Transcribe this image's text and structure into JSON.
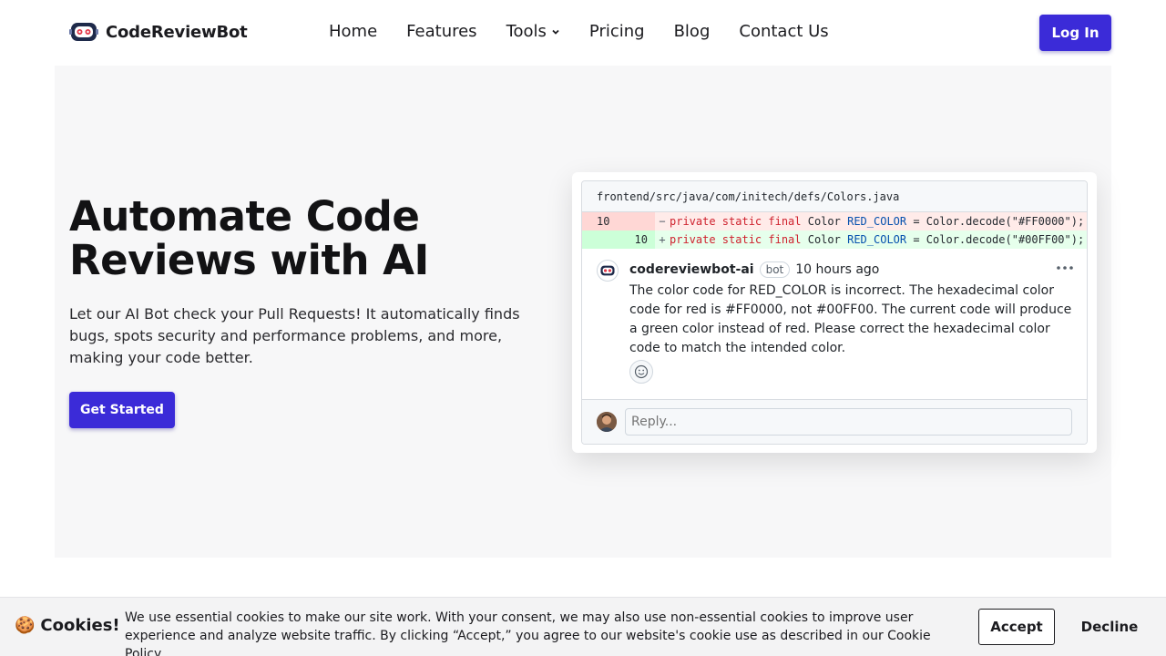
{
  "brand": {
    "name": "CodeReviewBot",
    "accent": "#3b2bd8",
    "logo_icon": "robot-icon"
  },
  "nav": {
    "items": [
      {
        "label": "Home"
      },
      {
        "label": "Features"
      },
      {
        "label": "Tools",
        "has_dropdown": true
      },
      {
        "label": "Pricing"
      },
      {
        "label": "Blog"
      },
      {
        "label": "Contact Us"
      }
    ],
    "login_label": "Log In"
  },
  "hero": {
    "title_line1": "Automate Code",
    "title_line2": "Reviews with AI",
    "subtitle": "Let our AI Bot check your Pull Requests! It automatically finds bugs, spots security and performance problems, and more, making your code better.",
    "cta_label": "Get Started"
  },
  "review": {
    "file_path": "frontend/src/java/com/initech/defs/Colors.java",
    "diff": [
      {
        "type": "del",
        "old_ln": "10",
        "new_ln": "",
        "sign": "−",
        "kw": "private static final",
        "type_name": "Color",
        "const": "RED_COLOR",
        "rest": " = Color.decode(\"#FF0000\");"
      },
      {
        "type": "add",
        "old_ln": "",
        "new_ln": "10",
        "sign": "+",
        "kw": "private static final",
        "type_name": "Color",
        "const": "RED_COLOR",
        "rest": " = Color.decode(\"#00FF00\");"
      }
    ],
    "comment": {
      "author": "codereviewbot-ai",
      "badge": "bot",
      "time": "10 hours ago",
      "body": "The color code for RED_COLOR is incorrect. The hexadecimal color code for red is #FF0000, not #00FF00. The current code will produce a green color instead of red. Please correct the hexadecimal color code to match the intended color."
    },
    "reply_placeholder": "Reply..."
  },
  "cookie": {
    "emoji": "🍪",
    "title": "Cookies!",
    "text": "We use essential cookies to make our site work. With your consent, we may also use non-essential cookies to improve user experience and analyze website traffic. By clicking “Accept,” you agree to our website's cookie use as described in our Cookie Policy.",
    "accept_label": "Accept",
    "decline_label": "Decline"
  }
}
